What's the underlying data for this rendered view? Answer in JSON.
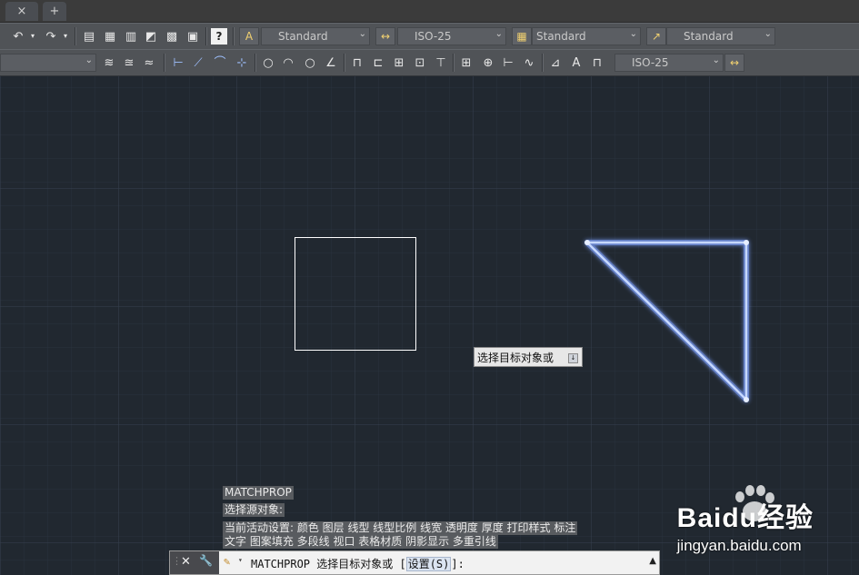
{
  "file_tabs": {
    "close_glyph": "×",
    "new_glyph": "+"
  },
  "toolbar1": {
    "text_style": "Standard",
    "dim_style": "ISO-25",
    "table_style": "Standard",
    "multileader_style": "Standard",
    "help_glyph": "?"
  },
  "toolbar2": {
    "layer_value": "",
    "dim_style": "ISO-25"
  },
  "tooltip": {
    "text": "选择目标对象或",
    "options_glyph": "↓"
  },
  "command_history": [
    "MATCHPROP",
    "选择源对象:",
    "当前活动设置:  颜色 图层 线型 线型比例 线宽 透明度 厚度 打印样式 标注",
    "文字 图案填充 多段线 视口 表格材质 阴影显示 多重引线"
  ],
  "command_line": {
    "prompt_prefix": "MATCHPROP 选择目标对象或 [",
    "option_label": "设置(S)",
    "prompt_suffix": "]:",
    "close_glyph": "✕",
    "wrench_glyph": "🔧",
    "scroll_glyph": "▲"
  },
  "watermark": {
    "brand": "Baidu经验",
    "url": "jingyan.baidu.com"
  },
  "colors": {
    "canvas_bg": "#212830",
    "rectangle_stroke": "#ffffff",
    "selected_stroke": "#bcd3ff",
    "selected_glow": "#6f8fe0"
  }
}
